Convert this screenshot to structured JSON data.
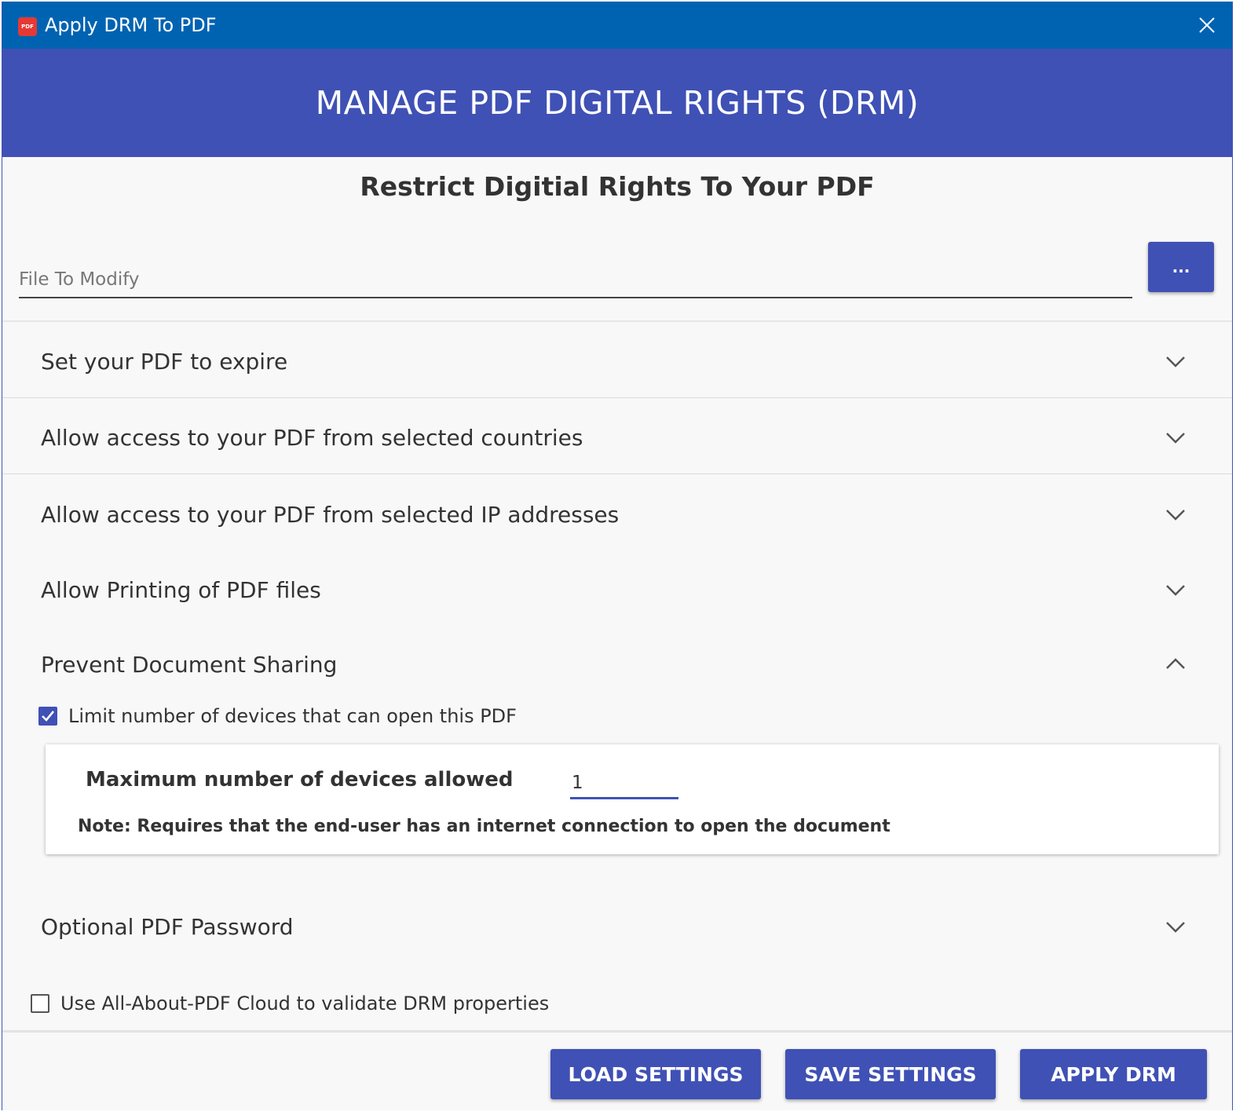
{
  "window": {
    "title": "Apply DRM To PDF",
    "app_icon_text": "PDF",
    "close_icon": "close-icon"
  },
  "banner": {
    "title": "MANAGE PDF DIGITAL RIGHTS (DRM)"
  },
  "subtitle": "Restrict Digitial Rights To Your PDF",
  "file": {
    "placeholder": "File To Modify",
    "value": "",
    "browse_label": "..."
  },
  "sections": [
    {
      "label": "Set your PDF to expire",
      "expanded": false,
      "icon": "chevron-down-icon"
    },
    {
      "label": "Allow access to your PDF from selected countries",
      "expanded": false,
      "icon": "chevron-down-icon"
    },
    {
      "label": "Allow access to your PDF from selected IP addresses",
      "expanded": false,
      "icon": "chevron-down-icon"
    },
    {
      "label": "Allow Printing of PDF files",
      "expanded": false,
      "icon": "chevron-down-icon"
    },
    {
      "label": "Prevent Document Sharing",
      "expanded": true,
      "icon": "chevron-up-icon"
    },
    {
      "label": "Optional PDF Password",
      "expanded": false,
      "icon": "chevron-down-icon"
    }
  ],
  "sharing": {
    "limit_devices_label": "Limit number of devices that can open this PDF",
    "limit_devices_checked": true,
    "max_devices_label": "Maximum number of devices allowed",
    "max_devices_value": "1",
    "note": "Note: Requires that the end-user has an internet connection to open the document"
  },
  "cloud": {
    "label": "Use All-About-PDF Cloud to validate DRM properties",
    "checked": false
  },
  "buttons": {
    "load": "LOAD SETTINGS",
    "save": "SAVE SETTINGS",
    "apply": "APPLY DRM"
  },
  "colors": {
    "titlebar": "#0063b1",
    "accent": "#3f51b5",
    "background": "#f8f8f8"
  }
}
